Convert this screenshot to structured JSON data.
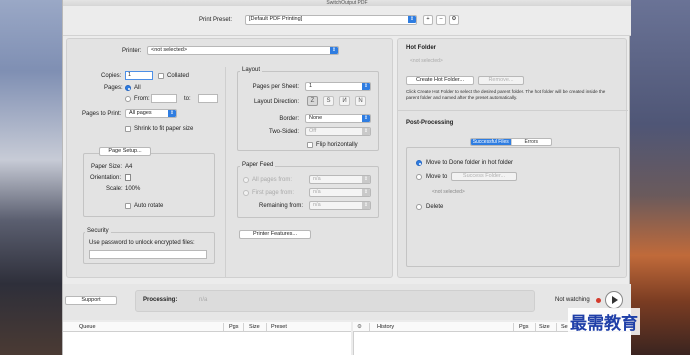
{
  "window": {
    "title": "SwitchOutput PDF"
  },
  "toolbar": {
    "print_preset_label": "Print Preset:",
    "print_preset_value": "[Default PDF Printing]",
    "add_label": "+",
    "remove_label": "–",
    "action_label": "⚙"
  },
  "printer": {
    "label": "Printer:",
    "value": "<not selected>"
  },
  "copies": {
    "label": "Copies:",
    "value": "1",
    "collated_label": "Collated"
  },
  "pages": {
    "label": "Pages:",
    "all_label": "All",
    "from_label": "From:",
    "to_label": "to:"
  },
  "pages_to_print": {
    "label": "Pages to Print:",
    "value": "All pages"
  },
  "shrink_label": "Shrink to fit paper size",
  "page_setup": {
    "button_label": "Page Setup...",
    "paper_size_label": "Paper Size:",
    "paper_size_value": "A4",
    "orientation_label": "Orientation:",
    "scale_label": "Scale:",
    "scale_value": "100%",
    "auto_rotate_label": "Auto rotate"
  },
  "security": {
    "title": "Security",
    "password_label": "Use password to unlock encrypted files:"
  },
  "layout": {
    "title": "Layout",
    "pages_per_sheet_label": "Pages per Sheet:",
    "pages_per_sheet_value": "1",
    "layout_direction_label": "Layout Direction:",
    "direction_icons": [
      "Z",
      "S",
      "И",
      "N"
    ],
    "border_label": "Border:",
    "border_value": "None",
    "two_sided_label": "Two-Sided:",
    "two_sided_value": "Off",
    "flip_label": "Flip horizontally"
  },
  "paper_feed": {
    "title": "Paper Feed",
    "all_pages_label": "All pages from:",
    "all_pages_value": "n/a",
    "first_page_label": "First page from:",
    "first_page_value": "n/a",
    "remaining_label": "Remaining from:",
    "remaining_value": "n/a"
  },
  "printer_features_label": "Printer Features...",
  "hot_folder": {
    "title": "Hot Folder",
    "path": "<not selected>",
    "create_label": "Create Hot Folder...",
    "remove_label": "Remove...",
    "help_text": "Click Create Hot Folder to select the desired parent folder. The hot folder will be created inside the parent folder and named after the preset automatically."
  },
  "post_processing": {
    "title": "Post-Processing",
    "tabs": [
      "Successful Files",
      "Errors"
    ],
    "move_done_label": "Move to Done folder in hot folder",
    "move_to_label": "Move to",
    "success_folder_label": "Success Folder...",
    "move_to_path": "<not selected>",
    "delete_label": "Delete"
  },
  "footer": {
    "support_label": "Support",
    "processing_label": "Processing:",
    "processing_value": "n/a",
    "not_watching_label": "Not watching"
  },
  "queue_table": {
    "columns": [
      "Queue",
      "Pgs",
      "Size",
      "Preset"
    ]
  },
  "history_table": {
    "columns": [
      "History",
      "Pgs",
      "Size",
      "Se"
    ]
  },
  "watermark": "最需教育"
}
